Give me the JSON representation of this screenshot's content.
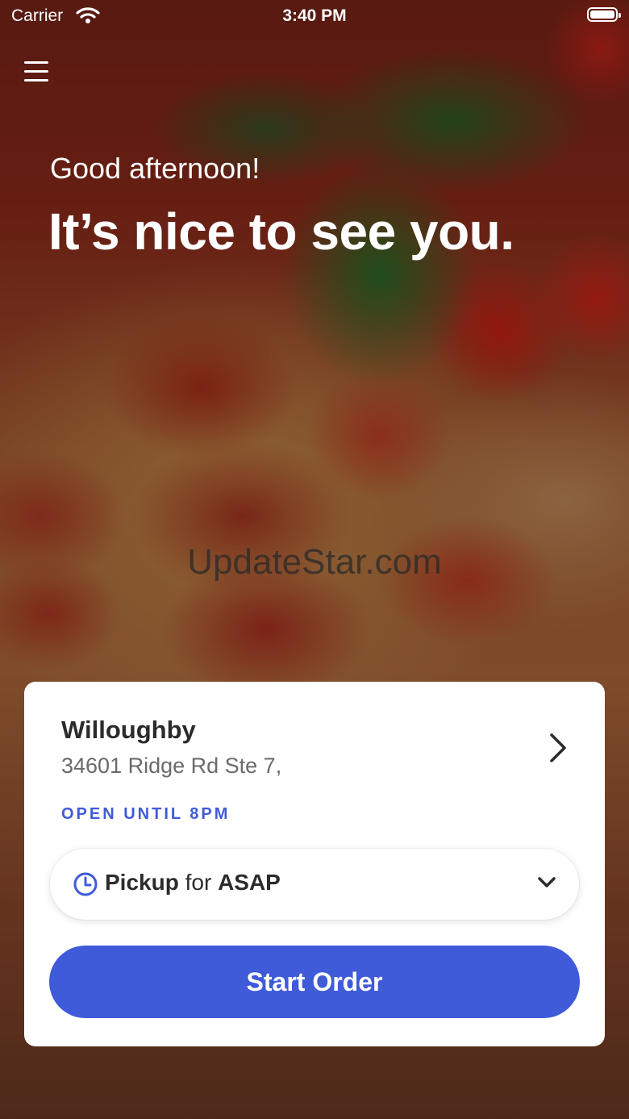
{
  "status_bar": {
    "carrier": "Carrier",
    "time": "3:40 PM"
  },
  "hero": {
    "greeting": "Good afternoon!",
    "headline": "It’s nice to see you.",
    "watermark": "UpdateStar.com"
  },
  "store": {
    "name": "Willoughby",
    "address": "34601 Ridge Rd Ste 7,",
    "hours": "OPEN UNTIL 8PM"
  },
  "order_mode": {
    "mode": "Pickup",
    "connector": "for",
    "time": "ASAP"
  },
  "actions": {
    "start_order": "Start Order"
  },
  "colors": {
    "accent": "#3f5bd9",
    "card_bg": "#ffffff",
    "text_dark": "#2b2b2b",
    "text_muted": "#6a6a6a"
  },
  "icons": {
    "menu": "hamburger-menu-icon",
    "wifi": "wifi-icon",
    "battery": "battery-icon",
    "store_detail": "chevron-right-icon",
    "time": "clock-icon",
    "dropdown": "chevron-down-icon"
  }
}
